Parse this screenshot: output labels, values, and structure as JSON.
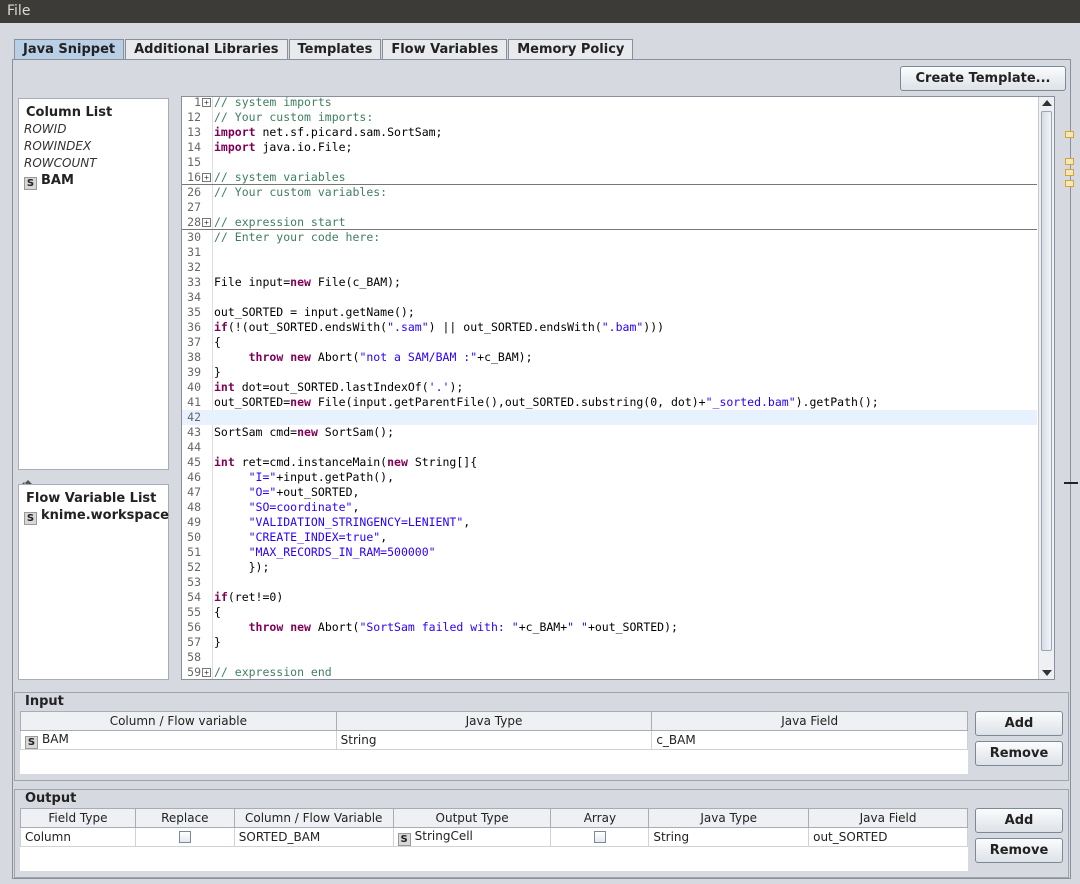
{
  "menubar": {
    "file": "File"
  },
  "tabs": [
    "Java Snippet",
    "Additional Libraries",
    "Templates",
    "Flow Variables",
    "Memory Policy"
  ],
  "create_template_label": "Create Template...",
  "column_list": {
    "title": "Column List",
    "items": [
      "ROWID",
      "ROWINDEX",
      "ROWCOUNT"
    ],
    "columns": [
      {
        "badge": "S",
        "name": "BAM"
      }
    ]
  },
  "flow_variable_list": {
    "title": "Flow Variable List",
    "items": [
      {
        "badge": "S",
        "name": "knime.workspace"
      }
    ]
  },
  "code_lines": [
    {
      "n": "1",
      "fold": true,
      "html": "<span class=\"c\">// system imports</span>"
    },
    {
      "n": "12",
      "html": "<span class=\"c\">// Your custom imports:</span>"
    },
    {
      "n": "13",
      "html": "<span class=\"k\">import</span> net.sf.picard.sam.SortSam;"
    },
    {
      "n": "14",
      "html": "<span class=\"k\">import</span> java.io.File;"
    },
    {
      "n": "15",
      "html": ""
    },
    {
      "n": "16",
      "fold": true,
      "sep": true,
      "html": "<span class=\"c\">// system variables</span>"
    },
    {
      "n": "26",
      "html": "<span class=\"c\">// Your custom variables:</span>"
    },
    {
      "n": "27",
      "html": ""
    },
    {
      "n": "28",
      "fold": true,
      "sep": true,
      "html": "<span class=\"c\">// expression start</span>"
    },
    {
      "n": "30",
      "html": "<span class=\"c\">// Enter your code here:</span>"
    },
    {
      "n": "31",
      "html": ""
    },
    {
      "n": "32",
      "html": ""
    },
    {
      "n": "33",
      "html": "File input=<span class=\"k\">new</span> File(c_BAM);"
    },
    {
      "n": "34",
      "html": ""
    },
    {
      "n": "35",
      "html": "out_SORTED = input.getName();"
    },
    {
      "n": "36",
      "html": "<span class=\"k\">if</span>(!(out_SORTED.endsWith(<span class=\"s\">\".sam\"</span>) || out_SORTED.endsWith(<span class=\"s\">\".bam\"</span>)))"
    },
    {
      "n": "37",
      "html": "{"
    },
    {
      "n": "38",
      "html": "     <span class=\"k\">throw</span> <span class=\"k\">new</span> Abort(<span class=\"s\">\"not a SAM/BAM :\"</span>+c_BAM);"
    },
    {
      "n": "39",
      "html": "}"
    },
    {
      "n": "40",
      "html": "<span class=\"k\">int</span> dot=out_SORTED.lastIndexOf(<span class=\"s\">'.'</span>);"
    },
    {
      "n": "41",
      "html": "out_SORTED=<span class=\"k\">new</span> File(input.getParentFile(),out_SORTED.substring(0, dot)+<span class=\"s\">\"_sorted.bam\"</span>).getPath();"
    },
    {
      "n": "42",
      "hl": true,
      "html": ""
    },
    {
      "n": "43",
      "html": "SortSam cmd=<span class=\"k\">new</span> SortSam();"
    },
    {
      "n": "44",
      "html": ""
    },
    {
      "n": "45",
      "html": "<span class=\"k\">int</span> ret=cmd.instanceMain(<span class=\"k\">new</span> String[]{"
    },
    {
      "n": "46",
      "html": "     <span class=\"s\">\"I=\"</span>+input.getPath(),"
    },
    {
      "n": "47",
      "html": "     <span class=\"s\">\"O=\"</span>+out_SORTED,"
    },
    {
      "n": "48",
      "html": "     <span class=\"s\">\"SO=coordinate\"</span>,"
    },
    {
      "n": "49",
      "html": "     <span class=\"s\">\"VALIDATION_STRINGENCY=LENIENT\"</span>,"
    },
    {
      "n": "50",
      "html": "     <span class=\"s\">\"CREATE_INDEX=true\"</span>,"
    },
    {
      "n": "51",
      "html": "     <span class=\"s\">\"MAX_RECORDS_IN_RAM=500000\"</span>"
    },
    {
      "n": "52",
      "html": "     });"
    },
    {
      "n": "53",
      "html": ""
    },
    {
      "n": "54",
      "html": "<span class=\"k\">if</span>(ret!=0)"
    },
    {
      "n": "55",
      "html": "{"
    },
    {
      "n": "56",
      "html": "     <span class=\"k\">throw</span> <span class=\"k\">new</span> Abort(<span class=\"s\">\"SortSam failed with: \"</span>+c_BAM+<span class=\"s\">\" \"</span>+out_SORTED);"
    },
    {
      "n": "57",
      "html": "}"
    },
    {
      "n": "58",
      "html": ""
    },
    {
      "n": "59",
      "fold": true,
      "html": "<span class=\"c\">// expression end</span>"
    }
  ],
  "input": {
    "title": "Input",
    "headers": [
      "Column / Flow variable",
      "Java Type",
      "Java Field"
    ],
    "rows": [
      {
        "badge": "S",
        "column": "BAM",
        "java_type": "String",
        "java_field": "c_BAM"
      }
    ],
    "add_label": "Add",
    "remove_label": "Remove"
  },
  "output": {
    "title": "Output",
    "headers": [
      "Field Type",
      "Replace",
      "Column / Flow Variable",
      "Output Type",
      "Array",
      "Java Type",
      "Java Field"
    ],
    "rows": [
      {
        "field_type": "Column",
        "replace": false,
        "column": "SORTED_BAM",
        "badge": "S",
        "output_type": "StringCell",
        "array": false,
        "java_type": "String",
        "java_field": "out_SORTED"
      }
    ],
    "add_label": "Add",
    "remove_label": "Remove"
  }
}
